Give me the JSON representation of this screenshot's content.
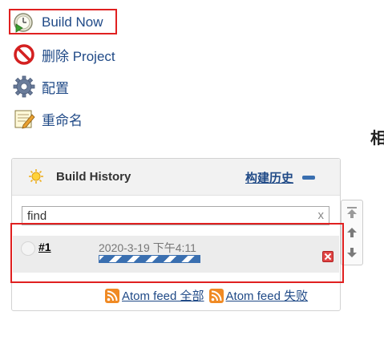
{
  "menu": {
    "build_now": {
      "label": "Build Now",
      "icon": "clock-play-icon"
    },
    "delete_project": {
      "label": "删除 Project",
      "icon": "no-entry-icon"
    },
    "configure": {
      "label": "配置",
      "icon": "gear-icon"
    },
    "rename": {
      "label": "重命名",
      "icon": "notepad-pencil-icon"
    }
  },
  "right_heading_fragment": "相",
  "build_history": {
    "title": "Build History",
    "trend_label": "构建历史",
    "search": {
      "value": "find",
      "clear": "x"
    },
    "builds": [
      {
        "number": "#1",
        "date": "2020-3-19 下午4:11",
        "progress": 1.0,
        "status": "running"
      }
    ],
    "feeds": [
      {
        "label": "Atom feed 全部"
      },
      {
        "label": "Atom feed 失败"
      }
    ]
  },
  "colors": {
    "link": "#204a87",
    "highlight": "#e02020",
    "progress": "#3a6fb0",
    "rss": "#f08a24"
  }
}
